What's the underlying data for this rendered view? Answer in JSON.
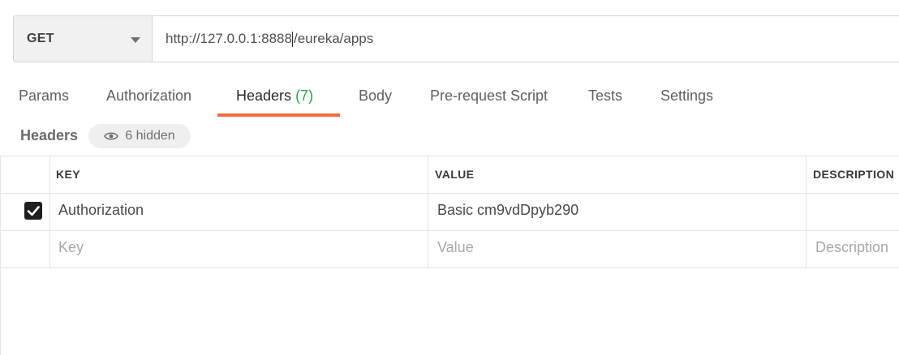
{
  "request": {
    "method": "GET",
    "url_before_cursor": "http://127.0.0.1:8888",
    "url_after_cursor": "/eureka/apps"
  },
  "tabs": [
    {
      "label": "Params"
    },
    {
      "label": "Authorization"
    },
    {
      "label": "Headers",
      "count": "(7)",
      "active": true
    },
    {
      "label": "Body"
    },
    {
      "label": "Pre-request Script"
    },
    {
      "label": "Tests"
    },
    {
      "label": "Settings"
    }
  ],
  "headers_section": {
    "title": "Headers",
    "hidden_label": "6 hidden"
  },
  "table": {
    "columns": {
      "key": "KEY",
      "value": "VALUE",
      "description": "DESCRIPTION"
    },
    "rows": [
      {
        "checked": true,
        "key": "Authorization",
        "value": "Basic cm9vdDpyb290",
        "description": ""
      }
    ],
    "placeholders": {
      "key": "Key",
      "value": "Value",
      "description": "Description"
    }
  },
  "colors": {
    "accent": "#f26b3a",
    "count": "#26a544"
  }
}
